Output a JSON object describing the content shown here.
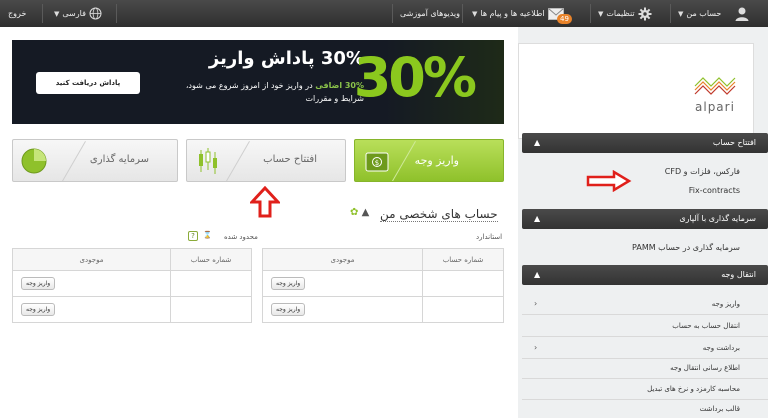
{
  "topbar": {
    "account_label": "حساب من",
    "settings_label": "تنظیمات",
    "notifications_count": "49",
    "messages_label": "اطلاعیه ها و پیام ها",
    "videos_label": "ویدیوهای آموزشی",
    "language_label": "فارسی",
    "logout_label": "خروج"
  },
  "banner": {
    "title": "30% پاداش واریز",
    "line1_highlight": "30% اضافی",
    "line1_rest": " در واریز خود از امروز شروع می شود،",
    "line2": "شرایط و مقررات",
    "big_text": "30%",
    "claim_button": "پاداش دریافت کنید"
  },
  "tiles": {
    "deposit": "واریز وجه",
    "open_account": "افتتاح حساب",
    "invest": "سرمایه گذاری"
  },
  "accounts": {
    "title": "حساب های شخصی من",
    "standard_label": "استاندارد",
    "limited_label": "محدود شده",
    "help_mark": "?",
    "col_account_number": "شماره حساب",
    "col_balance": "موجودی",
    "deposit_button": "واریز وجه"
  },
  "sidebar": {
    "logo_text": "alpari",
    "group_open_account": "افتتاح حساب",
    "link_forex": "فارکس، فلزات و CFD",
    "link_fix": "Fix-contracts",
    "group_invest": "سرمایه گذاری با آلپاری",
    "link_pamm": "سرمایه گذاری در حساب PAMM",
    "group_transfer": "انتقال وجه",
    "items": [
      {
        "label": "واریز وجه",
        "chevron": "›"
      },
      {
        "label": "انتقال حساب به حساب",
        "chevron": ""
      },
      {
        "label": "برداشت وجه",
        "chevron": "›"
      },
      {
        "label": "اطلاع رسانی انتقال وجه",
        "chevron": ""
      },
      {
        "label": "محاسبه کارمزد و نرخ های تبدیل",
        "chevron": ""
      },
      {
        "label": "قالب برداشت",
        "chevron": ""
      }
    ],
    "collapse_glyph": "▲"
  },
  "colors": {
    "accent_green": "#8fc12b",
    "topbar": "#3a3a3a",
    "arrow_red": "#e0201b",
    "badge_orange": "#e8832a"
  }
}
